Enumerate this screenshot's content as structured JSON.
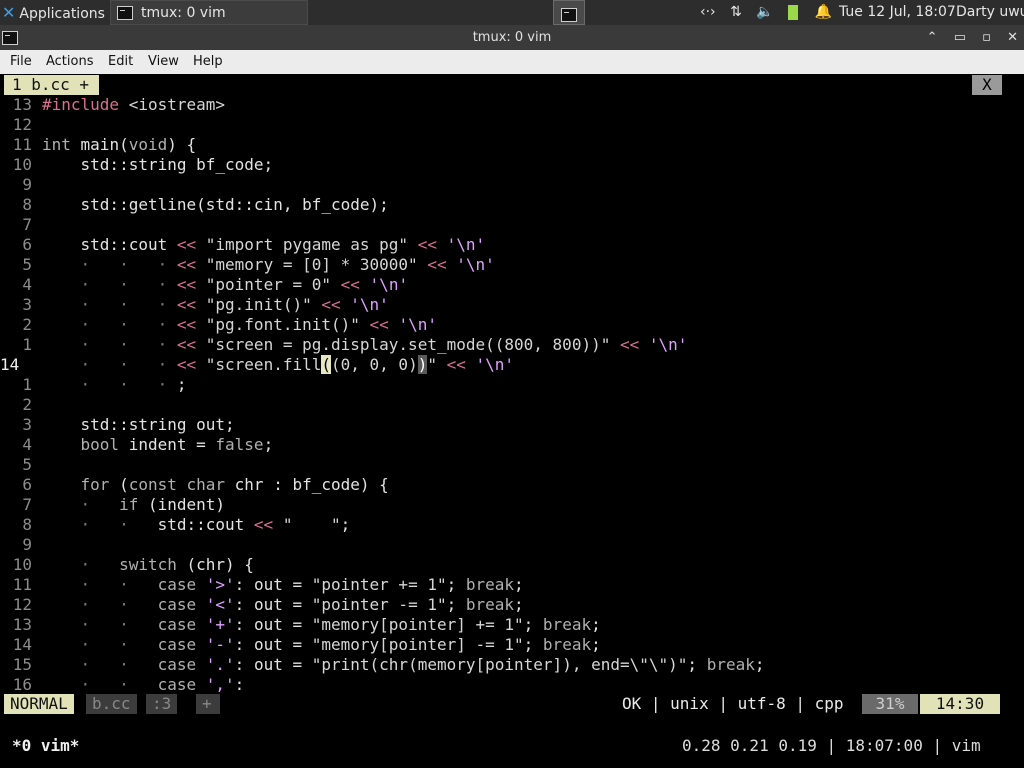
{
  "panel": {
    "apps_label": "Applications",
    "task_label": "tmux: 0 vim",
    "tray": {
      "net": "‹·›",
      "updown": "⇅",
      "volume": "🔈",
      "bell": "🔔"
    },
    "clock": "Tue 12 Jul, 18:07",
    "user": "Darty uwu"
  },
  "window": {
    "title": "tmux: 0 vim",
    "controls": {
      "up": "⌃",
      "min": "▭",
      "max": "▫",
      "close": "✕"
    }
  },
  "menubar": {
    "file": "File",
    "actions": "Actions",
    "edit": "Edit",
    "view": "View",
    "help": "Help"
  },
  "vim": {
    "tab_label": "1  b.cc  +",
    "tab_close": "X",
    "status": {
      "mode": "NORMAL",
      "file": "b.cc",
      "line": ":3",
      "plus": "+",
      "info": "OK  |  unix  |  utf-8  |  cpp",
      "percent": "31%",
      "position": "14:30"
    }
  },
  "tmux": {
    "window": "*0 vim*",
    "right": "0.28 0.21 0.19 | 18:07:00 | vim"
  },
  "colors": {
    "accent": "#e2e2b8",
    "background": "#000000",
    "panel": "#2d2d2d"
  }
}
